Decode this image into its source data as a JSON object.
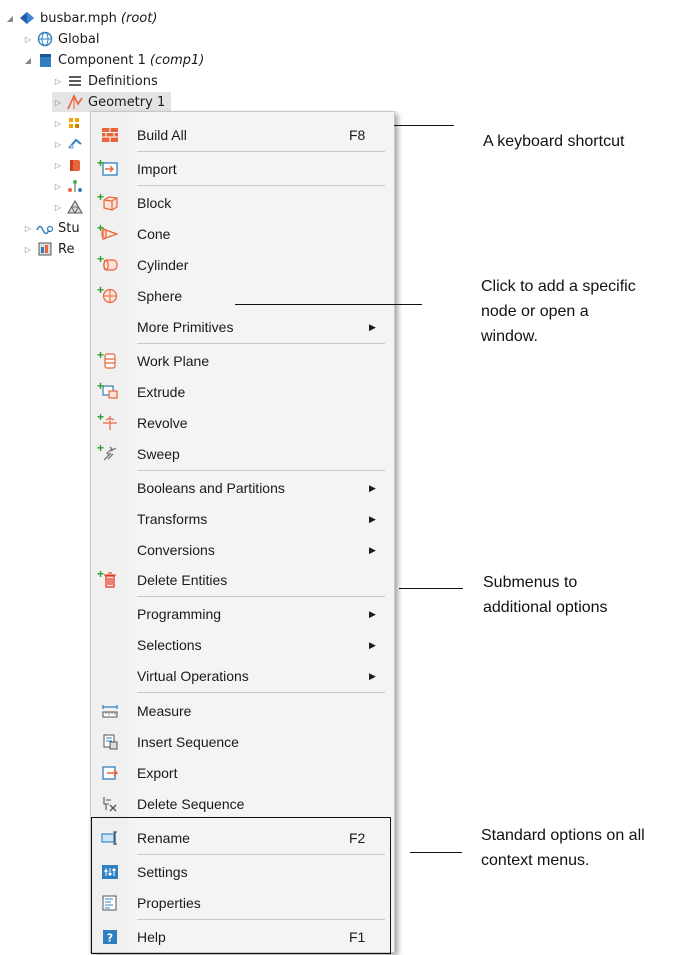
{
  "tree": {
    "root": {
      "name": "busbar.mph",
      "note": "(root)"
    },
    "global": "Global",
    "component": {
      "name": "Component 1",
      "note": "(comp1)"
    },
    "definitions": "Definitions",
    "geometry": "Geometry 1",
    "study_partial": "Stu",
    "results_partial": "Re"
  },
  "menu": {
    "build_all": {
      "label": "Build All",
      "shortcut": "F8"
    },
    "import": "Import",
    "block": "Block",
    "cone": "Cone",
    "cylinder": "Cylinder",
    "sphere": "Sphere",
    "more_primitives": "More Primitives",
    "work_plane": "Work Plane",
    "extrude": "Extrude",
    "revolve": "Revolve",
    "sweep": "Sweep",
    "booleans": "Booleans and Partitions",
    "transforms": "Transforms",
    "conversions": "Conversions",
    "delete_entities": "Delete Entities",
    "programming": "Programming",
    "selections": "Selections",
    "virtual_operations": "Virtual Operations",
    "measure": "Measure",
    "insert_sequence": "Insert Sequence",
    "export": "Export",
    "delete_sequence": "Delete Sequence",
    "rename": {
      "label": "Rename",
      "shortcut": "F2"
    },
    "settings": "Settings",
    "properties": "Properties",
    "help": {
      "label": "Help",
      "shortcut": "F1"
    }
  },
  "annotations": {
    "shortcut": "A keyboard shortcut",
    "click_line1": "Click to add a specific",
    "click_line2": "node or open a",
    "click_line3": "window.",
    "submenus_line1": "Submenus to",
    "submenus_line2": "additional options",
    "standard_line1": "Standard options on all",
    "standard_line2": "context menus."
  },
  "colors": {
    "accent_green": "#2aa02a",
    "icon_orange": "#e8643c",
    "icon_blue": "#2f7fc1"
  }
}
